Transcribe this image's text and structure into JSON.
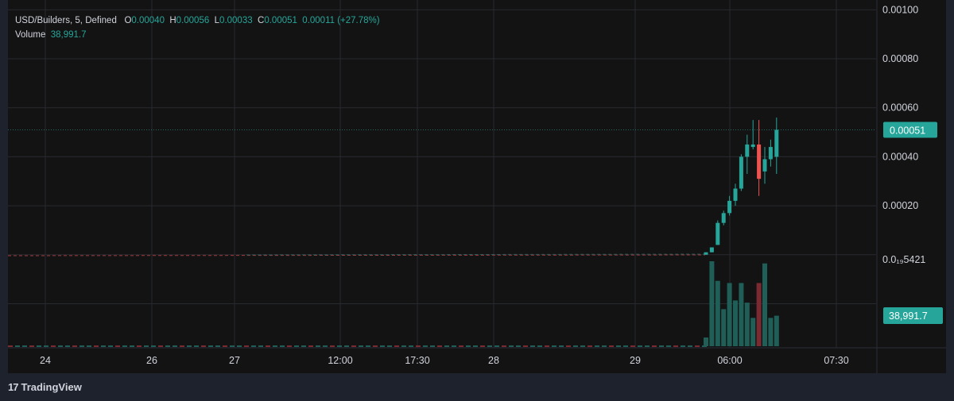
{
  "header": {
    "symbol": "USD/Builders, 5, Defined",
    "o_label": "O",
    "o_value": "0.00040",
    "h_label": "H",
    "h_value": "0.00056",
    "l_label": "L",
    "l_value": "0.00033",
    "c_label": "C",
    "c_value": "0.00051",
    "change": "0.00011 (+27.78%)",
    "volume_label": "Volume",
    "volume_value": "38,991.7"
  },
  "footer": {
    "logo_mark": "17",
    "logo_text": "TradingView"
  },
  "colors": {
    "background": "#131313",
    "grid": "#272a2f",
    "up": "#26a69a",
    "down": "#ef5350",
    "up_volume": "#1f5f57",
    "down_volume": "#7a2a30",
    "axis_text": "#d1d4dc"
  },
  "chart_data": {
    "type": "candlestick",
    "price_axis": {
      "ticks": [
        0.001,
        0.0008,
        0.0006,
        0.0004,
        0.0002
      ],
      "tick_labels": [
        "0.00100",
        "0.00080",
        "0.00060",
        "0.00040",
        "0.00020"
      ],
      "extra_label": "0.0₁₉5421",
      "current_price": 0.00051,
      "current_price_label": "0.00051",
      "volume_label": "38,991.7",
      "ylim": [
        -0.00038,
        0.00104
      ]
    },
    "time_axis": {
      "labels": [
        "24",
        "26",
        "27",
        "12:00",
        "17:30",
        "28",
        "29",
        "06:00",
        "07:30"
      ]
    },
    "candles": [
      {
        "o": 0.0,
        "h": 1e-05,
        "l": 0.0,
        "c": 1e-05
      },
      {
        "o": 1e-05,
        "h": 3e-05,
        "l": 1e-05,
        "c": 3e-05
      },
      {
        "o": 4e-05,
        "h": 0.00014,
        "l": 4e-05,
        "c": 0.00013
      },
      {
        "o": 0.00013,
        "h": 0.00018,
        "l": 0.00012,
        "c": 0.00017
      },
      {
        "o": 0.00017,
        "h": 0.00024,
        "l": 0.00016,
        "c": 0.00022
      },
      {
        "o": 0.00022,
        "h": 0.00029,
        "l": 0.0002,
        "c": 0.00027
      },
      {
        "o": 0.00027,
        "h": 0.00041,
        "l": 0.00026,
        "c": 0.0004
      },
      {
        "o": 0.0004,
        "h": 0.00049,
        "l": 0.00033,
        "c": 0.00045
      },
      {
        "o": 0.00044,
        "h": 0.00055,
        "l": 0.00043,
        "c": 0.00045
      },
      {
        "o": 0.00045,
        "h": 0.00055,
        "l": 0.00024,
        "c": 0.00031
      },
      {
        "o": 0.00034,
        "h": 0.00044,
        "l": 0.00029,
        "c": 0.00039
      },
      {
        "o": 0.00039,
        "h": 0.00047,
        "l": 0.00036,
        "c": 0.00044
      },
      {
        "o": 0.0004,
        "h": 0.00056,
        "l": 0.00033,
        "c": 0.00051
      }
    ],
    "volumes": [
      {
        "v": 4000,
        "dir": "up"
      },
      {
        "v": 39000,
        "dir": "up"
      },
      {
        "v": 30000,
        "dir": "up"
      },
      {
        "v": 17000,
        "dir": "up"
      },
      {
        "v": 29000,
        "dir": "up"
      },
      {
        "v": 21000,
        "dir": "up"
      },
      {
        "v": 29000,
        "dir": "up"
      },
      {
        "v": 20000,
        "dir": "up"
      },
      {
        "v": 13000,
        "dir": "up"
      },
      {
        "v": 29000,
        "dir": "down"
      },
      {
        "v": 38000,
        "dir": "up"
      },
      {
        "v": 13000,
        "dir": "up"
      },
      {
        "v": 14000,
        "dir": "up"
      }
    ],
    "grid": true
  }
}
